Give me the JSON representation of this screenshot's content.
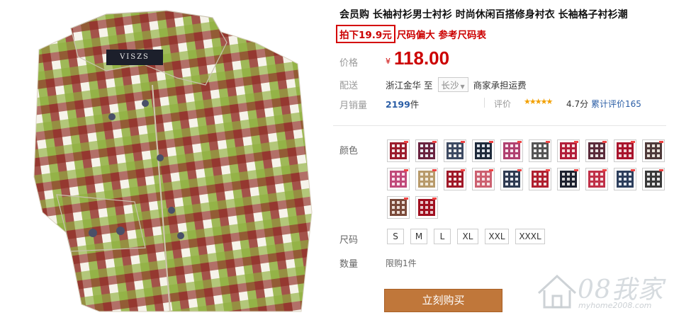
{
  "product": {
    "title": "会员购 长袖衬衫男士衬衫 时尚休闲百搭修身衬衣 长袖格子衬衫潮",
    "promo_boxed": "拍下19.9元",
    "promo_rest": "尺码偏大 参考尺码表",
    "brand_label": "VISZS"
  },
  "price": {
    "label": "价格",
    "currency": "¥",
    "value": "118.00"
  },
  "shipping": {
    "label": "配送",
    "from": "浙江金华",
    "to_word": "至",
    "city": "长沙",
    "note": "商家承担运费"
  },
  "sales": {
    "label": "月销量",
    "count": "2199",
    "unit": "件"
  },
  "rating": {
    "label": "评价",
    "stars": "★★★★★",
    "score": "4.7分",
    "reviews": "累计评价165"
  },
  "color": {
    "label": "颜色",
    "swatches": [
      {
        "c1": "#9b1c2c",
        "c2": "#f3e8e8"
      },
      {
        "c1": "#6a2340",
        "c2": "#eaeaf0"
      },
      {
        "c1": "#3d4a62",
        "c2": "#ececec"
      },
      {
        "c1": "#1f2b3c",
        "c2": "#dde3ea"
      },
      {
        "c1": "#b04070",
        "c2": "#f7e6ee"
      },
      {
        "c1": "#555555",
        "c2": "#eeeeee"
      },
      {
        "c1": "#b21e3a",
        "c2": "#f5dede"
      },
      {
        "c1": "#5a2a3a",
        "c2": "#e7e2e2"
      },
      {
        "c1": "#a8132c",
        "c2": "#f0d2d6"
      },
      {
        "c1": "#4e3a3a",
        "c2": "#e9e2da"
      },
      {
        "c1": "#c04a7a",
        "c2": "#f8e2ec"
      },
      {
        "c1": "#b89a6a",
        "c2": "#f1eadc"
      },
      {
        "c1": "#a01828",
        "c2": "#f3e2e2"
      },
      {
        "c1": "#cc6070",
        "c2": "#f6e4e6"
      },
      {
        "c1": "#2f3b52",
        "c2": "#e5e8ee"
      },
      {
        "c1": "#b02030",
        "c2": "#efe0e0"
      },
      {
        "c1": "#1e2230",
        "c2": "#d8d8d8"
      },
      {
        "c1": "#c03048",
        "c2": "#f3dde0"
      },
      {
        "c1": "#2c3e5c",
        "c2": "#e0e6ee"
      },
      {
        "c1": "#3a3a3a",
        "c2": "#e5e5e5"
      },
      {
        "c1": "#7a4a3a",
        "c2": "#eadcd4"
      },
      {
        "c1": "#a01020",
        "c2": "#e8c8cc"
      }
    ]
  },
  "size": {
    "label": "尺码",
    "options": [
      "S",
      "M",
      "L",
      "XL",
      "XXL",
      "XXXL"
    ]
  },
  "quantity": {
    "label": "数量",
    "limit": "限购1件"
  },
  "buy_label": "立刻购买",
  "watermark": {
    "text": "08我家",
    "url": "myhome2008.com"
  }
}
